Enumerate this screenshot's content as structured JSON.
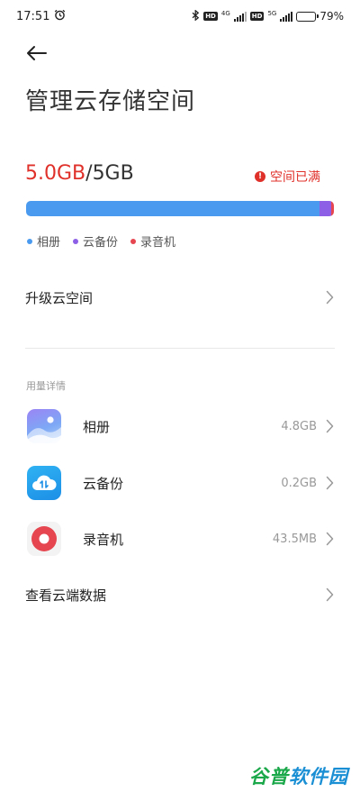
{
  "status_bar": {
    "time": "17:51",
    "alarm_icon": "alarm-clock-icon",
    "bluetooth_icon": "bluetooth-icon",
    "sim1": {
      "hd": "HD",
      "network": "4G"
    },
    "sim2": {
      "hd": "HD",
      "network": "5G"
    },
    "battery_percent": "79%",
    "battery_level": 0.79
  },
  "header": {
    "back_icon": "arrow-left-icon",
    "title": "管理云存储空间"
  },
  "storage": {
    "used": "5.0GB",
    "separator": "/",
    "total": "5GB",
    "status_text": "空间已满",
    "status_icon": "exclamation-circle-icon",
    "segments": [
      {
        "name": "相册",
        "fraction": 0.96,
        "color": "#4a9bf0"
      },
      {
        "name": "云备份",
        "fraction": 0.04,
        "color": "#8c5fe6"
      },
      {
        "name": "录音机",
        "fraction": 0.008,
        "color": "#e5464f"
      }
    ]
  },
  "upgrade": {
    "label": "升级云空间"
  },
  "details": {
    "section_label": "用量详情",
    "items": [
      {
        "name": "相册",
        "size": "4.8GB",
        "icon": "gallery-icon"
      },
      {
        "name": "云备份",
        "size": "0.2GB",
        "icon": "cloud-backup-icon"
      },
      {
        "name": "录音机",
        "size": "43.5MB",
        "icon": "recorder-icon"
      }
    ],
    "view_cloud_label": "查看云端数据"
  },
  "watermark": {
    "part1": "谷普",
    "part2": "软件园"
  },
  "colors": {
    "accent_red": "#e0302a",
    "gallery_blue": "#4a9bf0",
    "backup_purple": "#8c5fe6",
    "recorder_red": "#e5464f"
  }
}
